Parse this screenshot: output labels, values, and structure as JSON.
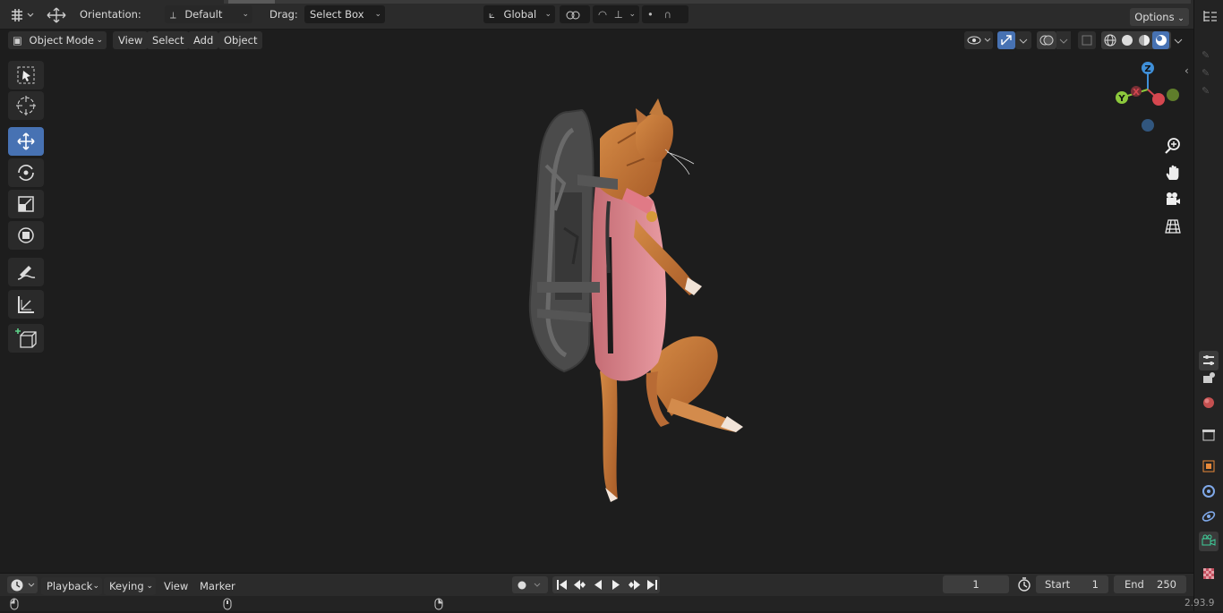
{
  "header": {
    "orientation_label": "Orientation:",
    "orientation_value": "Default",
    "drag_label": "Drag:",
    "drag_value": "Select Box",
    "transform_orientation": "Global",
    "options_label": "Options"
  },
  "menubar": {
    "mode": "Object Mode",
    "items": [
      "View",
      "Select",
      "Add",
      "Object"
    ]
  },
  "toolbar": {
    "tools": [
      "select-box",
      "cursor",
      "move",
      "rotate",
      "scale",
      "transform",
      "annotate",
      "measure",
      "add-cube"
    ],
    "active_tool": "move"
  },
  "gizmo": {
    "z": "Z",
    "y": "Y",
    "x": "X"
  },
  "timeline": {
    "playback": "Playback",
    "keying": "Keying",
    "view": "View",
    "marker": "Marker",
    "current_frame": "1",
    "start_label": "Start",
    "start_value": "1",
    "end_label": "End",
    "end_value": "250"
  },
  "status": {
    "version": "2.93.9"
  },
  "colors": {
    "accent": "#4772b3",
    "x_axis": "#d5474f",
    "y_axis": "#8cc83c",
    "z_axis": "#3f8fd8",
    "viewport_bg": "#1d1d1d"
  }
}
